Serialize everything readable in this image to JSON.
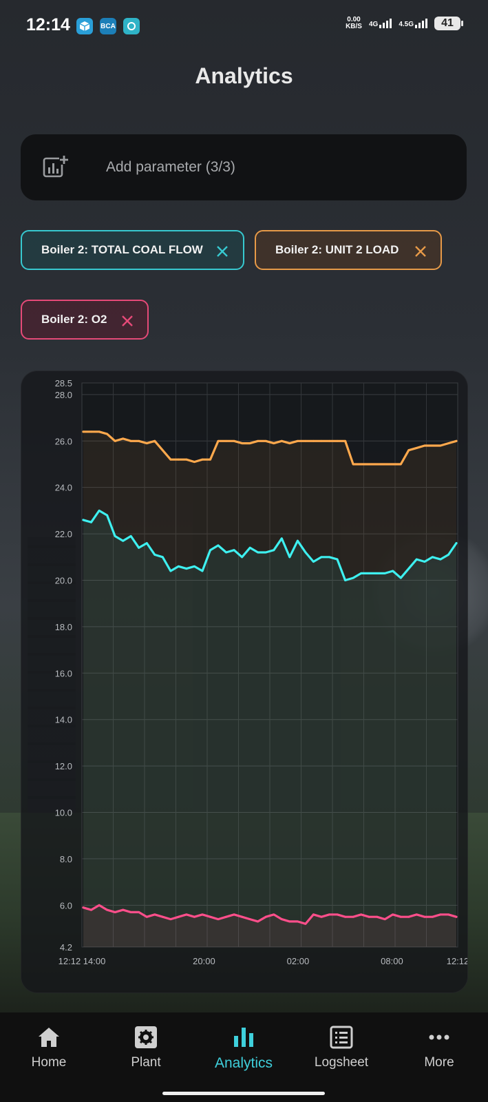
{
  "status_bar": {
    "time": "12:14",
    "app_icons": [
      "box-app-icon",
      "bca-app-icon",
      "refresh-app-icon"
    ],
    "bca_text": "BCA",
    "net_speed_value": "0.00",
    "net_speed_unit": "KB/S",
    "signal_1": "4G",
    "signal_2": "4.5G",
    "battery": "41"
  },
  "page": {
    "title": "Analytics"
  },
  "add_parameter": {
    "label": "Add parameter (3/3)",
    "icon": "add-chart-icon"
  },
  "chips": [
    {
      "label": "Boiler 2: TOTAL COAL FLOW",
      "color": "#37c9d0"
    },
    {
      "label": "Boiler 2: UNIT 2 LOAD",
      "color": "#e79a48"
    },
    {
      "label": "Boiler 2: O2",
      "color": "#e64a78"
    }
  ],
  "chart_data": {
    "type": "line",
    "ylim": [
      4.2,
      28.5
    ],
    "y_ticks": [
      "28.5",
      "28.0",
      "26.0",
      "24.0",
      "22.0",
      "20.0",
      "18.0",
      "16.0",
      "14.0",
      "12.0",
      "10.0",
      "8.0",
      "6.0",
      "4.2"
    ],
    "x_ticks": [
      "12:12 14:00",
      "20:00",
      "02:00",
      "08:00",
      "12:12"
    ],
    "grid": true,
    "series": [
      {
        "color": "#ffa94d",
        "values": [
          26.4,
          26.4,
          26.4,
          26.3,
          26.0,
          26.1,
          26.0,
          26.0,
          25.9,
          26.0,
          25.6,
          25.2,
          25.2,
          25.2,
          25.1,
          25.2,
          25.2,
          26.0,
          26.0,
          26.0,
          25.9,
          25.9,
          26.0,
          26.0,
          25.9,
          26.0,
          25.9,
          26.0,
          26.0,
          26.0,
          26.0,
          26.0,
          26.0,
          26.0,
          25.0,
          25.0,
          25.0,
          25.0,
          25.0,
          25.0,
          25.0,
          25.6,
          25.7,
          25.8,
          25.8,
          25.8,
          25.9,
          26.0
        ]
      },
      {
        "color": "#3ef0f0",
        "values": [
          22.6,
          22.5,
          23.0,
          22.8,
          21.9,
          21.7,
          21.9,
          21.4,
          21.6,
          21.1,
          21.0,
          20.4,
          20.6,
          20.5,
          20.6,
          20.4,
          21.3,
          21.5,
          21.2,
          21.3,
          21.0,
          21.4,
          21.2,
          21.2,
          21.3,
          21.8,
          21.0,
          21.7,
          21.2,
          20.8,
          21.0,
          21.0,
          20.9,
          20.0,
          20.1,
          20.3,
          20.3,
          20.3,
          20.3,
          20.4,
          20.1,
          20.5,
          20.9,
          20.8,
          21.0,
          20.9,
          21.1,
          21.6
        ]
      },
      {
        "color": "#ff4f8b",
        "values": [
          5.9,
          5.8,
          6.0,
          5.8,
          5.7,
          5.8,
          5.7,
          5.7,
          5.5,
          5.6,
          5.5,
          5.4,
          5.5,
          5.6,
          5.5,
          5.6,
          5.5,
          5.4,
          5.5,
          5.6,
          5.5,
          5.4,
          5.3,
          5.5,
          5.6,
          5.4,
          5.3,
          5.3,
          5.2,
          5.6,
          5.5,
          5.6,
          5.6,
          5.5,
          5.5,
          5.6,
          5.5,
          5.5,
          5.4,
          5.6,
          5.5,
          5.5,
          5.6,
          5.5,
          5.5,
          5.6,
          5.6,
          5.5
        ]
      }
    ]
  },
  "nav": {
    "items": [
      {
        "label": "Home",
        "icon": "home-icon"
      },
      {
        "label": "Plant",
        "icon": "gear-icon"
      },
      {
        "label": "Analytics",
        "icon": "bar-chart-icon"
      },
      {
        "label": "Logsheet",
        "icon": "list-icon"
      },
      {
        "label": "More",
        "icon": "more-dots-icon"
      }
    ],
    "active_color": "#3fd0dc"
  }
}
